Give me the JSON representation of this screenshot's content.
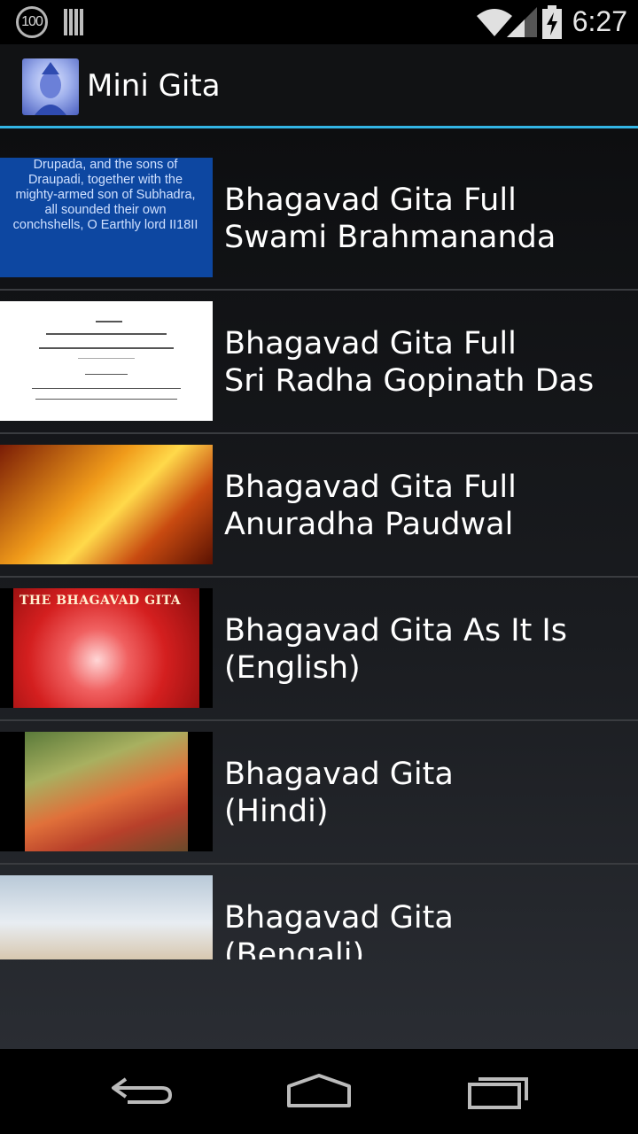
{
  "status_bar": {
    "notification_badge": "100",
    "time": "6:27",
    "icons": [
      "battery-100-icon",
      "sd-card-icon",
      "wifi-icon",
      "cell-signal-icon",
      "battery-charging-icon"
    ]
  },
  "action_bar": {
    "title": "Mini Gita",
    "accent_color": "#33b5e5"
  },
  "list": {
    "items": [
      {
        "title": "Bhagavad Gita Full\nSwami Brahmananda",
        "thumb_text": "Drupada, and the sons of Draupadi, together with the mighty-armed son of Subhadra, all sounded their own conchshells, O Earthly lord II18II"
      },
      {
        "title": "Bhagavad Gita Full\nSri Radha Gopinath Das",
        "thumb_text": "sañjaya uvāca dṛṣṭvā tu pāṇḍavānīkaṁ vyūḍhaṁ duryodhanas tadā ācāryam upasaṅgamya rājā vacanam abravīt"
      },
      {
        "title": "Bhagavad Gita Full\nAnuradha Paudwal",
        "thumb_text": ""
      },
      {
        "title": "Bhagavad Gita As It Is\n(English)",
        "thumb_text": "THE BHAGAVAD GITA"
      },
      {
        "title": "Bhagavad Gita\n(Hindi)",
        "thumb_text": ""
      },
      {
        "title": "Bhagavad Gita\n(Bengali)",
        "thumb_text": ""
      }
    ]
  },
  "nav_bar": {
    "buttons": [
      "back-icon",
      "home-icon",
      "recent-apps-icon"
    ]
  }
}
